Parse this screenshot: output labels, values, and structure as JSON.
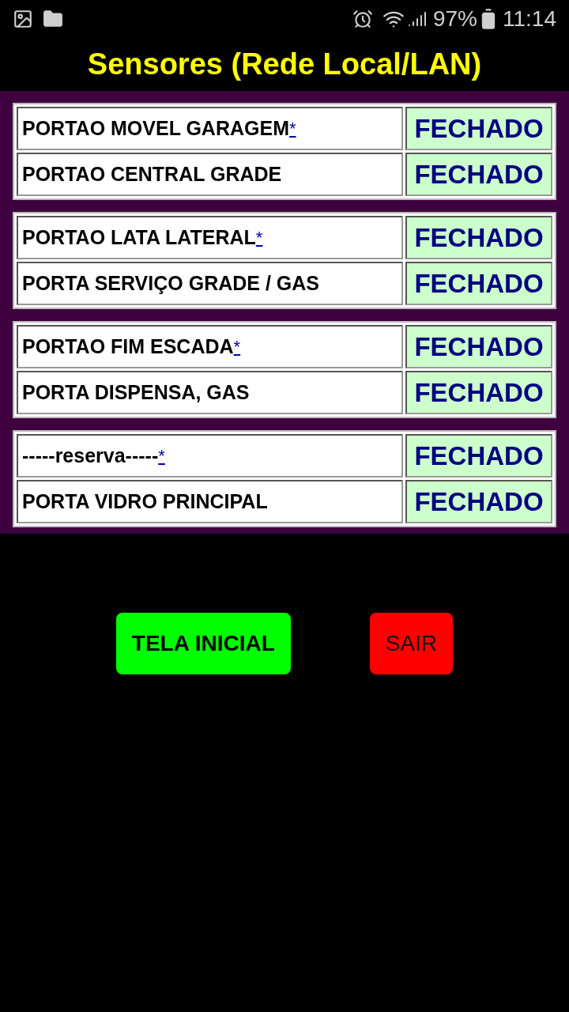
{
  "status_bar": {
    "battery": "97%",
    "time": "11:14"
  },
  "title": "Sensores (Rede Local/LAN)",
  "groups": [
    {
      "sensors": [
        {
          "name": "PORTAO MOVEL GARAGEM",
          "link": "*",
          "status": "FECHADO"
        },
        {
          "name": "PORTAO CENTRAL GRADE",
          "status": "FECHADO"
        }
      ]
    },
    {
      "sensors": [
        {
          "name": "PORTAO LATA LATERAL",
          "link": "*",
          "status": "FECHADO"
        },
        {
          "name": "PORTA SERVIÇO GRADE / GAS",
          "status": "FECHADO"
        }
      ]
    },
    {
      "sensors": [
        {
          "name": "PORTAO FIM ESCADA",
          "link": "*",
          "status": "FECHADO"
        },
        {
          "name": "PORTA DISPENSA, GAS",
          "status": "FECHADO"
        }
      ]
    },
    {
      "sensors": [
        {
          "name": "-----reserva-----",
          "link": "*",
          "status": "FECHADO"
        },
        {
          "name": "PORTA VIDRO PRINCIPAL",
          "status": "FECHADO"
        }
      ]
    }
  ],
  "buttons": [
    {
      "label": "TELA INICIAL",
      "kind": "home"
    },
    {
      "label": "SAIR",
      "kind": "exit"
    }
  ]
}
